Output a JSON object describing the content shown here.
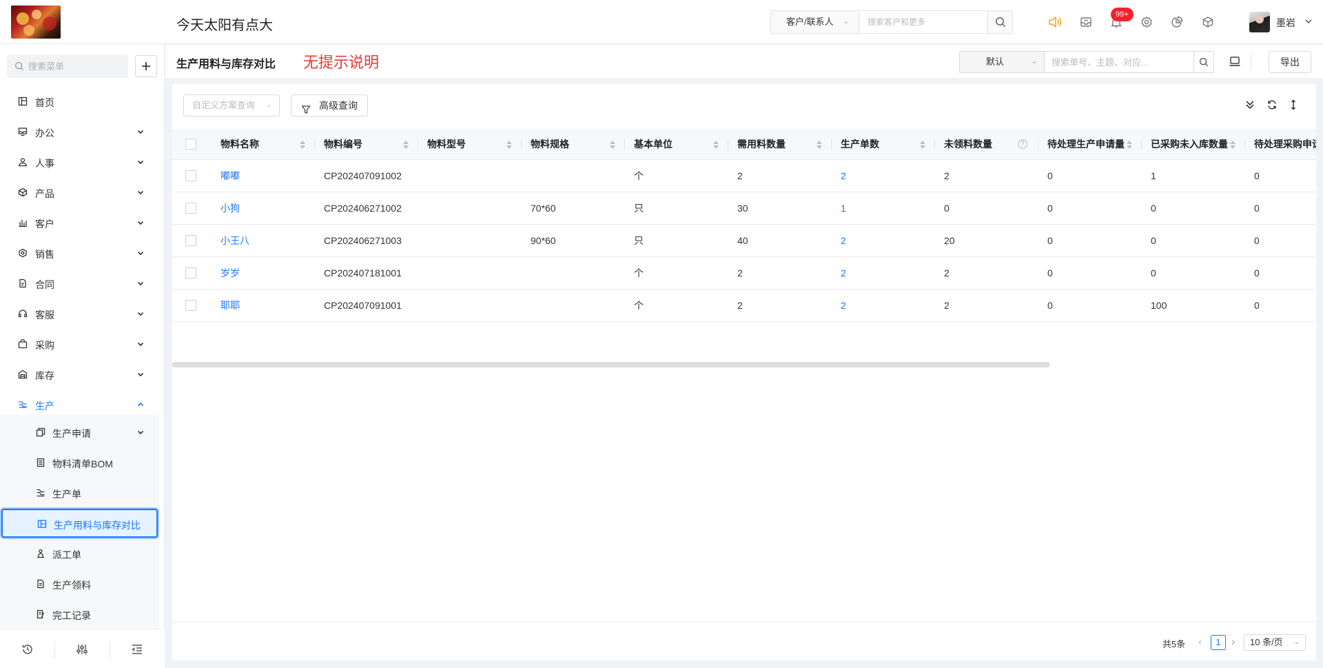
{
  "app": {
    "org_name": "今天太阳有点大",
    "search_scope": "客户/联系人",
    "search_placeholder": "搜索客户和更多",
    "notification_badge": "99+",
    "user_name": "墨岩"
  },
  "sidebar": {
    "search_placeholder": "搜索菜单",
    "items": [
      {
        "label": "首页",
        "icon": "home-icon",
        "has_arrow": false
      },
      {
        "label": "办公",
        "icon": "office-icon",
        "has_arrow": true
      },
      {
        "label": "人事",
        "icon": "people-icon",
        "has_arrow": true
      },
      {
        "label": "产品",
        "icon": "product-icon",
        "has_arrow": true
      },
      {
        "label": "客户",
        "icon": "customer-icon",
        "has_arrow": true
      },
      {
        "label": "销售",
        "icon": "sales-icon",
        "has_arrow": true
      },
      {
        "label": "合同",
        "icon": "contract-icon",
        "has_arrow": true
      },
      {
        "label": "客服",
        "icon": "headset-icon",
        "has_arrow": true
      },
      {
        "label": "采购",
        "icon": "purchase-icon",
        "has_arrow": true
      },
      {
        "label": "库存",
        "icon": "warehouse-icon",
        "has_arrow": true
      },
      {
        "label": "生产",
        "icon": "production-icon",
        "has_arrow": true,
        "expanded": true
      }
    ],
    "subitems": [
      {
        "label": "生产申请",
        "icon": "copy-icon",
        "has_arrow": true
      },
      {
        "label": "物料清单BOM",
        "icon": "bom-icon"
      },
      {
        "label": "生产单",
        "icon": "production-order-icon"
      },
      {
        "label": "生产用料与库存对比",
        "icon": "compare-icon",
        "active": true
      },
      {
        "label": "派工单",
        "icon": "dispatch-icon"
      },
      {
        "label": "生产领料",
        "icon": "document-icon"
      },
      {
        "label": "完工记录",
        "icon": "record-icon"
      }
    ]
  },
  "page": {
    "title": "生产用料与库存对比",
    "hint": "无提示说明",
    "view_select": "默认",
    "search_placeholder": "搜索单号、主题、对应...",
    "export_label": "导出",
    "scheme_placeholder": "自定义方案查询",
    "advanced_query_label": "高级查询"
  },
  "table": {
    "columns": [
      "物料名称",
      "物料编号",
      "物料型号",
      "物料规格",
      "基本单位",
      "需用料数量",
      "生产单数",
      "未领料数量",
      "待处理生产申请量",
      "已采购未入库数量",
      "待处理采购申请"
    ],
    "rows": [
      [
        "嘟嘟",
        "CP202407091002",
        "",
        "",
        "个",
        "2",
        "2",
        "2",
        "0",
        "1",
        "0"
      ],
      [
        "小狗",
        "CP202406271002",
        "",
        "70*60",
        "只",
        "30",
        "1",
        "0",
        "0",
        "0",
        "0"
      ],
      [
        "小王八",
        "CP202406271003",
        "",
        "90*60",
        "只",
        "40",
        "2",
        "20",
        "0",
        "0",
        "0"
      ],
      [
        "岁岁",
        "CP202407181001",
        "",
        "",
        "个",
        "2",
        "2",
        "2",
        "0",
        "0",
        "0"
      ],
      [
        "耶耶",
        "CP202407091001",
        "",
        "",
        "个",
        "2",
        "2",
        "2",
        "0",
        "100",
        "0"
      ]
    ]
  },
  "pagination": {
    "total": "共5条",
    "current_page": "1",
    "page_size": "10 条/页"
  },
  "colors": {
    "primary": "#1677ff",
    "hint_red": "#e53935",
    "badge_red": "#f5222d",
    "speaker_orange": "#f5a623"
  }
}
